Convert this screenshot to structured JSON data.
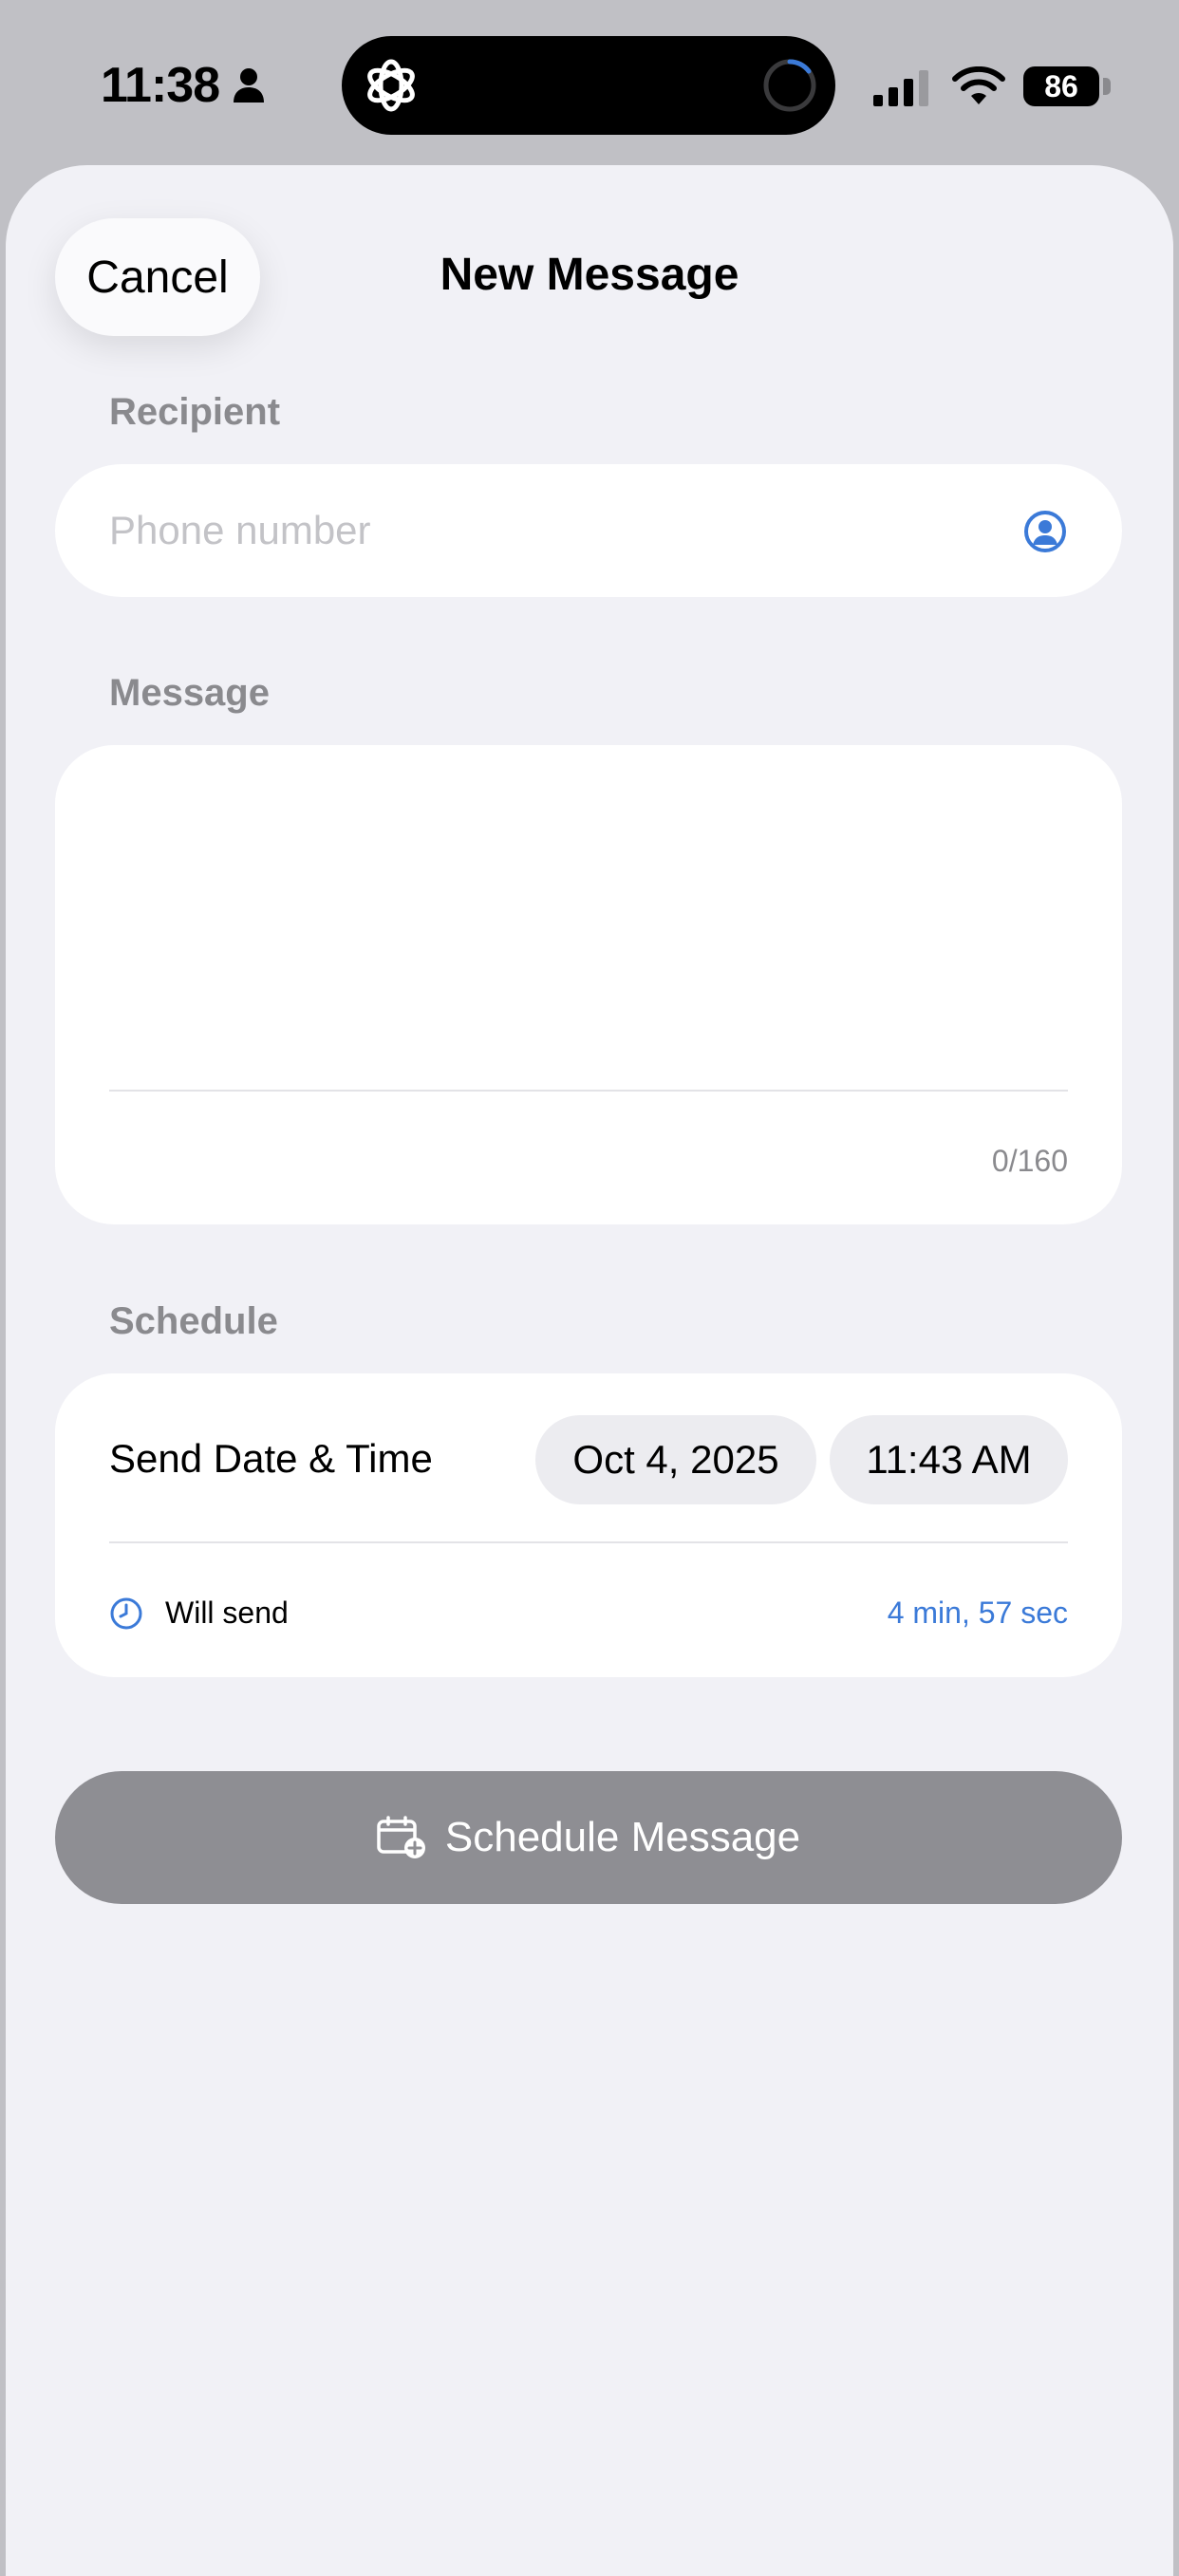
{
  "status_bar": {
    "time": "11:38",
    "battery": "86"
  },
  "nav": {
    "cancel_label": "Cancel",
    "title": "New Message"
  },
  "recipient": {
    "section_label": "Recipient",
    "placeholder": "Phone number",
    "value": ""
  },
  "message": {
    "section_label": "Message",
    "value": "",
    "char_count": "0/160"
  },
  "schedule": {
    "section_label": "Schedule",
    "send_label": "Send Date & Time",
    "date": "Oct 4, 2025",
    "time": "11:43 AM",
    "will_send_label": "Will send",
    "countdown": "4 min, 57 sec"
  },
  "action": {
    "schedule_label": "Schedule Message"
  },
  "colors": {
    "accent": "#3b7ad8",
    "button_disabled": "#8e8e93",
    "sheet_background": "#f1f1f6"
  },
  "icons": [
    "person-icon",
    "chatgpt-logo-icon",
    "loading-spinner-icon",
    "cellular-signal-icon",
    "wifi-icon",
    "battery-icon",
    "contact-picker-icon",
    "clock-icon",
    "calendar-add-icon"
  ]
}
